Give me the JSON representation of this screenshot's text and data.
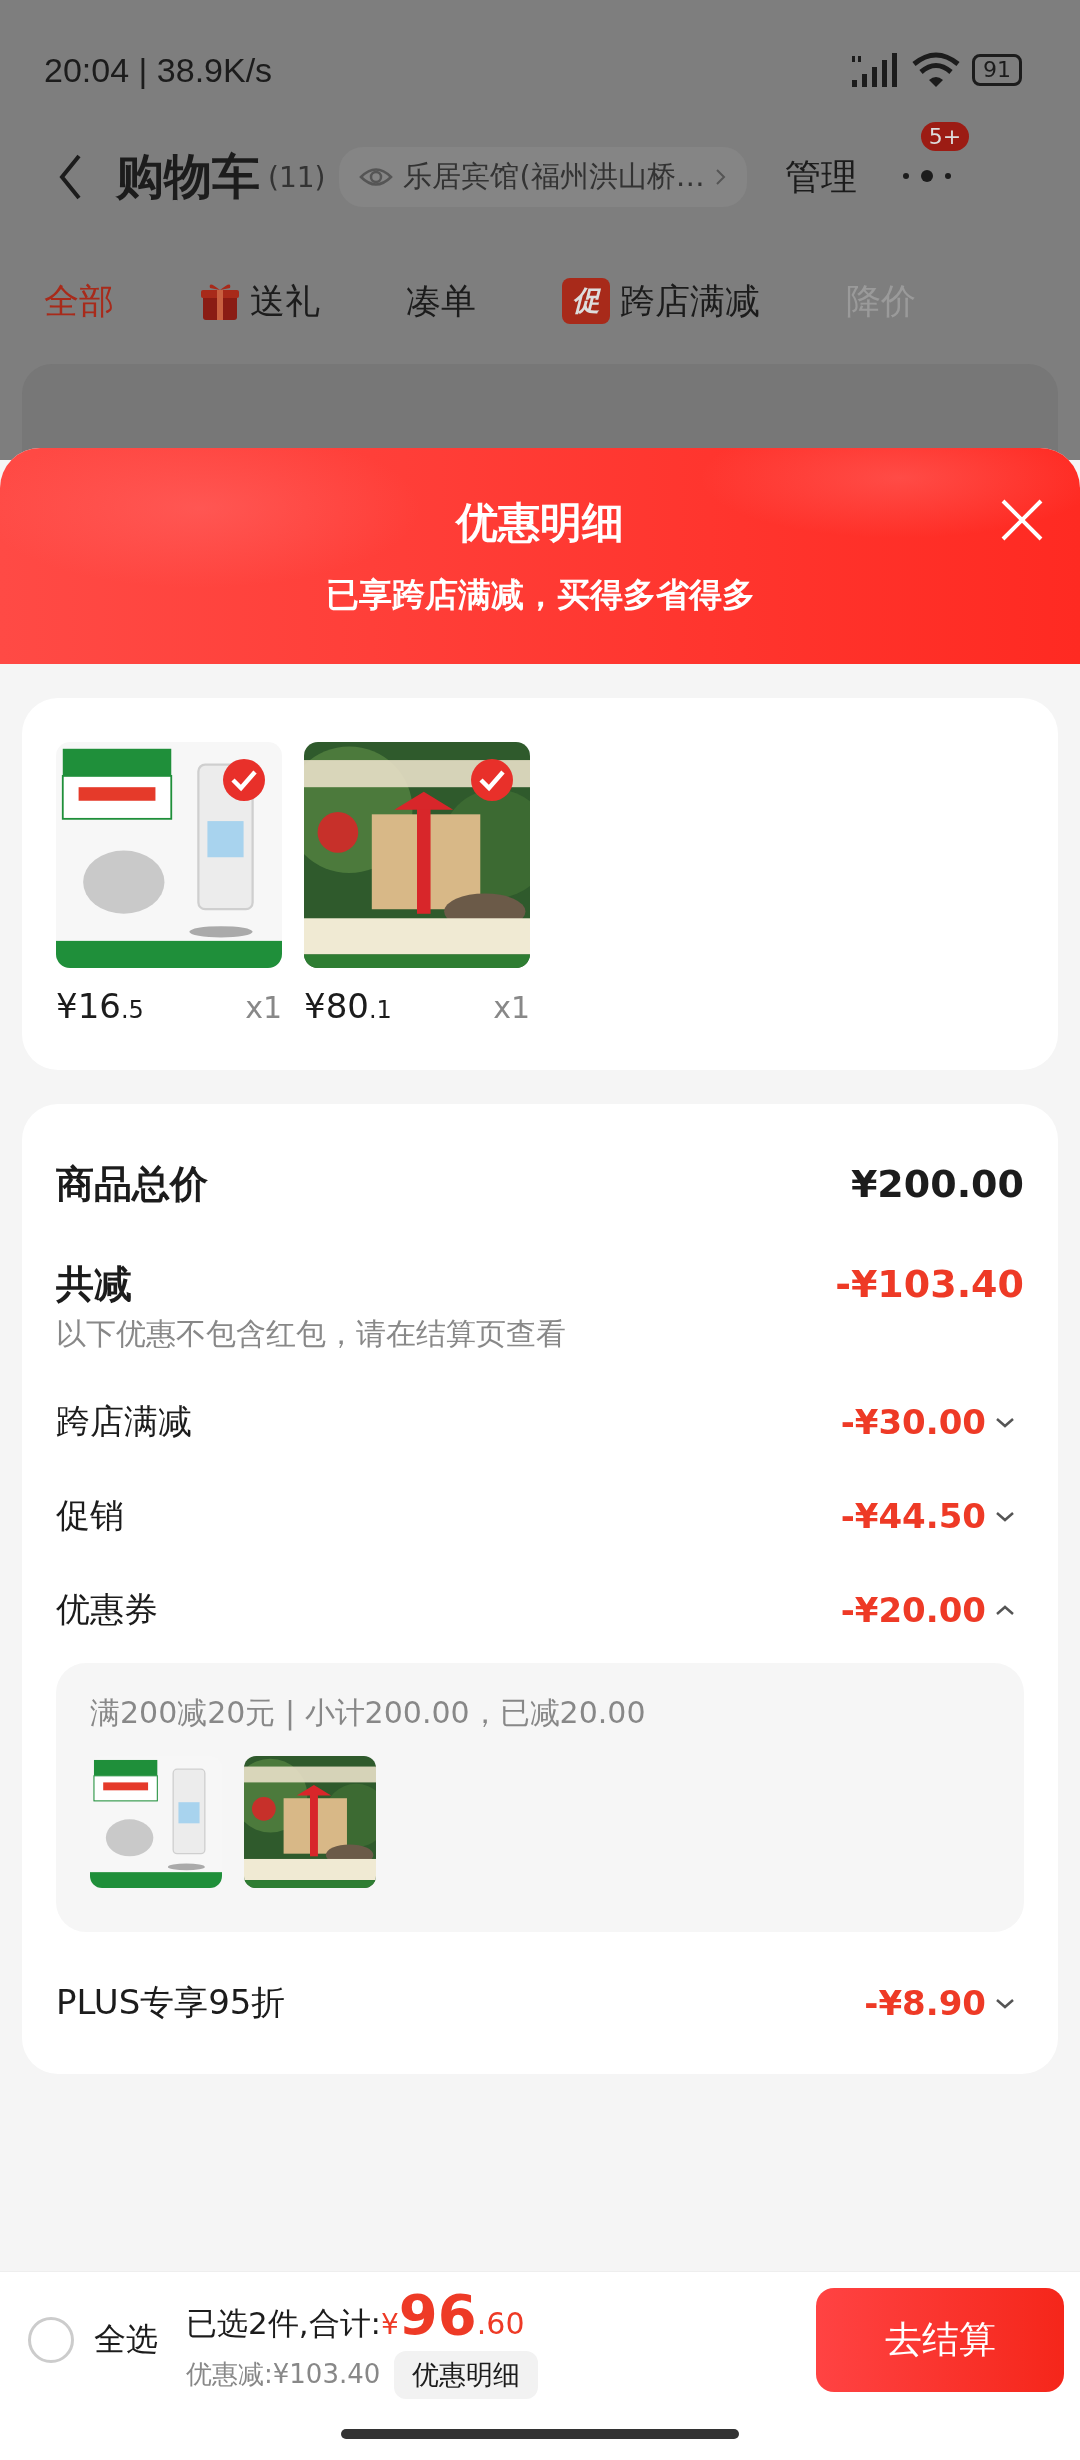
{
  "status_bar": {
    "time": "20:04 | 38.9K/s",
    "battery": "91"
  },
  "nav": {
    "title": "购物车",
    "count": "(11)",
    "address": "乐居宾馆(福州洪山桥…",
    "manage": "管理",
    "badge": "5+"
  },
  "tabs": [
    {
      "label": "全部",
      "selected": true,
      "kind": "plain"
    },
    {
      "label": "送礼",
      "selected": false,
      "kind": "gift"
    },
    {
      "label": "凑单",
      "selected": false,
      "kind": "plain"
    },
    {
      "label": "跨店满减",
      "selected": false,
      "kind": "promo",
      "tag": "促"
    },
    {
      "label": "降价",
      "selected": false,
      "kind": "dim"
    }
  ],
  "sheet": {
    "title": "优惠明细",
    "subtitle": "已享跨店满减，买得多省得多",
    "products": [
      {
        "kind": "picture",
        "checked": true,
        "price": "¥16",
        "price_decimal": ".5",
        "qty": "x1"
      },
      {
        "kind": "picture",
        "checked": true,
        "price": "¥80",
        "price_decimal": ".1",
        "qty": "x1"
      }
    ],
    "total": {
      "label": "商品总价",
      "value": "¥200.00"
    },
    "discount": {
      "label": "共减",
      "value": "-¥103.40",
      "note": "以下优惠不包含红包，请在结算页查看"
    },
    "items": [
      {
        "label": "跨店满减",
        "value": "-¥30.00",
        "expanded": false
      },
      {
        "label": "促销",
        "value": "-¥44.50",
        "expanded": false
      },
      {
        "label": "优惠券",
        "value": "-¥20.00",
        "expanded": true,
        "detail": {
          "text": "满200减20元 | 小计200.00，已减20.00"
        }
      },
      {
        "label": "PLUS专享95折",
        "value": "-¥8.90",
        "expanded": false
      }
    ]
  },
  "bottom_bar": {
    "select_all": {
      "label": "全选",
      "checked": false
    },
    "summary": "已选2件,合计:",
    "currency": "¥",
    "amount": "96",
    "amount_decimal": ".60",
    "saved": "优惠减:¥103.40",
    "detail_button": "优惠明细",
    "checkout": "去结算"
  }
}
